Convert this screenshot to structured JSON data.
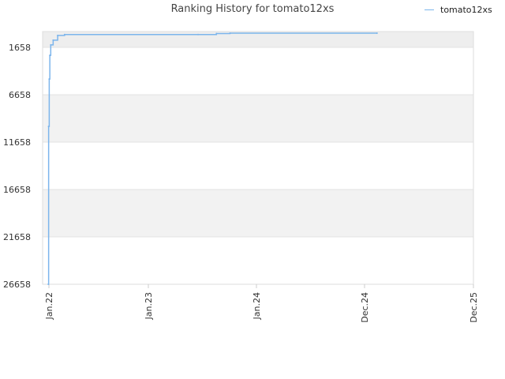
{
  "chart_data": {
    "type": "line",
    "title": "Ranking History for tomato12xs",
    "xlabel": "",
    "ylabel": "",
    "y_inverted": true,
    "ylim": [
      1658,
      26658
    ],
    "y_ticks": [
      "1658",
      "6658",
      "11658",
      "16658",
      "21658",
      "26658"
    ],
    "x_ticks": [
      "Jan.22",
      "Jan.23",
      "Jan.24",
      "Dec.24",
      "Dec.25"
    ],
    "grid": true,
    "legend_position": "top-right",
    "series": [
      {
        "name": "tomato12xs",
        "color": "#7cb5ec",
        "points": [
          [
            "2022-01-20",
            26658
          ],
          [
            "2022-01-21",
            10000
          ],
          [
            "2022-01-23",
            5000
          ],
          [
            "2022-01-25",
            2500
          ],
          [
            "2022-01-28",
            1400
          ],
          [
            "2022-02-05",
            900
          ],
          [
            "2022-02-20",
            400
          ],
          [
            "2022-03-15",
            300
          ],
          [
            "2023-06-01",
            300
          ],
          [
            "2023-08-01",
            200
          ],
          [
            "2023-09-15",
            100
          ],
          [
            "2025-01-15",
            100
          ]
        ]
      }
    ]
  }
}
